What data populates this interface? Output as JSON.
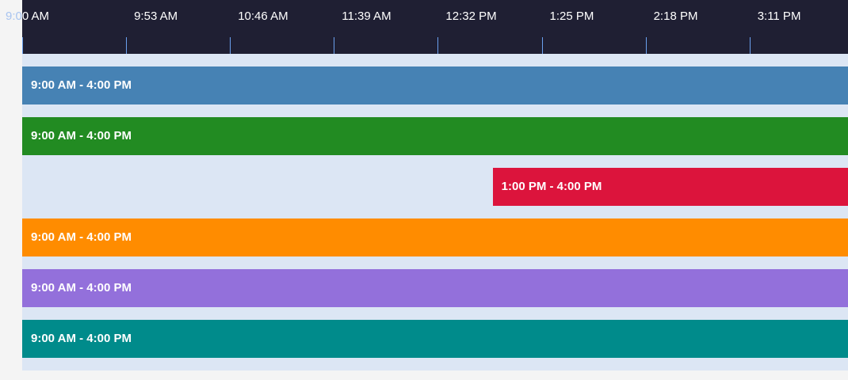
{
  "timeline": {
    "start_minutes": 540,
    "end_minutes": 960,
    "tick_labels": [
      "9:00 AM",
      "9:53 AM",
      "10:46 AM",
      "11:39 AM",
      "12:32 PM",
      "1:25 PM",
      "2:18 PM",
      "3:11 PM"
    ],
    "tick_minutes": [
      540,
      593,
      646,
      699,
      752,
      805,
      858,
      911
    ]
  },
  "events": [
    {
      "label": "9:00 AM - 4:00 PM",
      "start_minutes": 540,
      "end_minutes": 960,
      "color": "#4682b4"
    },
    {
      "label": "9:00 AM - 4:00 PM",
      "start_minutes": 540,
      "end_minutes": 960,
      "color": "#228b22"
    },
    {
      "label": "1:00 PM - 4:00 PM",
      "start_minutes": 780,
      "end_minutes": 960,
      "color": "#dc143c"
    },
    {
      "label": "9:00 AM - 4:00 PM",
      "start_minutes": 540,
      "end_minutes": 960,
      "color": "#ff8c00"
    },
    {
      "label": "9:00 AM - 4:00 PM",
      "start_minutes": 540,
      "end_minutes": 960,
      "color": "#9370db"
    },
    {
      "label": "9:00 AM - 4:00 PM",
      "start_minutes": 540,
      "end_minutes": 960,
      "color": "#008b8b"
    }
  ]
}
